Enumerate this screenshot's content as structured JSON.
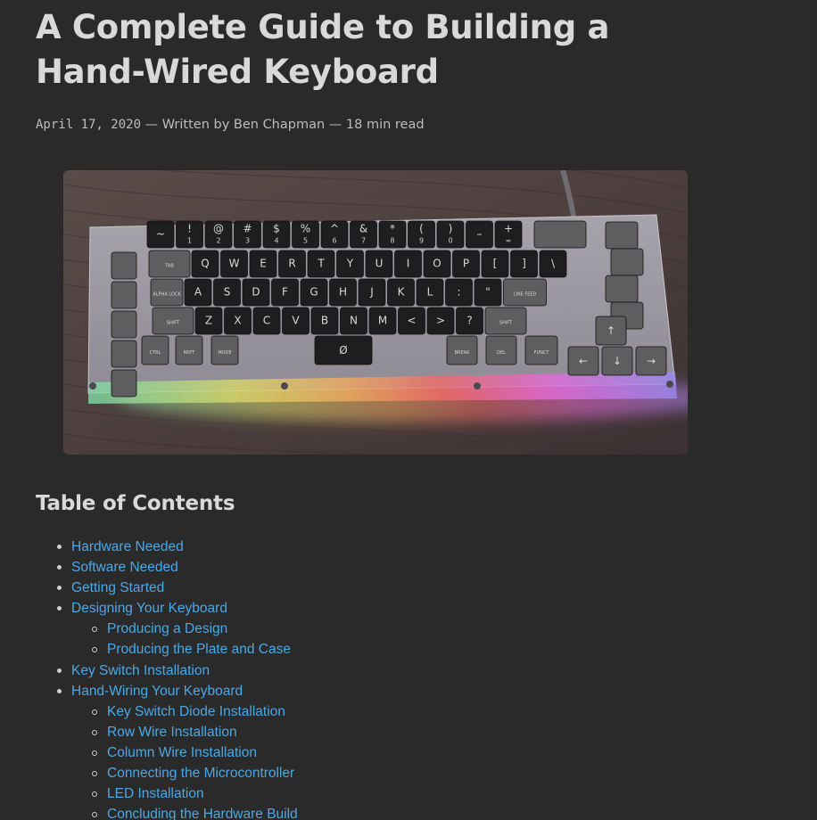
{
  "article": {
    "title": "A Complete Guide to Building a Hand-Wired Keyboard",
    "meta": {
      "date": "April 17, 2020",
      "separator1": " — ",
      "author": "Written by Ben Chapman",
      "separator2": " — ",
      "read_time": "18 min read"
    },
    "hero_image": {
      "keycap_legends": {
        "row1": [
          "~",
          "!",
          "@",
          "#",
          "$",
          "%",
          "^",
          "&",
          "*",
          "(",
          ")",
          "–",
          "+"
        ],
        "row1_sub": [
          "",
          "1",
          "2",
          "3",
          "4",
          "5",
          "6",
          "7",
          "8",
          "9",
          "0",
          "",
          "="
        ],
        "row2": [
          "TAB",
          "Q",
          "W",
          "E",
          "R",
          "T",
          "Y",
          "U",
          "I",
          "O",
          "P",
          "[",
          "]",
          "\\"
        ],
        "row3": [
          "ALPHA LOCK",
          "A",
          "S",
          "D",
          "F",
          "G",
          "H",
          "J",
          "K",
          "L",
          ":",
          "\"",
          "LINE FEED"
        ],
        "row4": [
          "SHIFT",
          "Z",
          "X",
          "C",
          "V",
          "B",
          "N",
          "M",
          "<",
          ">",
          "?",
          "SHIFT"
        ],
        "row5": [
          "CTRL",
          "REPT",
          "MODE",
          "Ø",
          "BREAK",
          "DEL",
          "FUNCT"
        ]
      }
    }
  },
  "toc": {
    "heading": "Table of Contents",
    "items": [
      {
        "label": "Hardware Needed",
        "level": 1
      },
      {
        "label": "Software Needed",
        "level": 1
      },
      {
        "label": "Getting Started",
        "level": 1
      },
      {
        "label": "Designing Your Keyboard",
        "level": 1
      },
      {
        "label": "Producing a Design",
        "level": 2
      },
      {
        "label": "Producing the Plate and Case",
        "level": 2
      },
      {
        "label": "Key Switch Installation",
        "level": 1
      },
      {
        "label": "Hand-Wiring Your Keyboard",
        "level": 1
      },
      {
        "label": "Key Switch Diode Installation",
        "level": 2
      },
      {
        "label": "Row Wire Installation",
        "level": 2
      },
      {
        "label": "Column Wire Installation",
        "level": 2
      },
      {
        "label": "Connecting the Microcontroller",
        "level": 2
      },
      {
        "label": "LED Installation",
        "level": 2
      },
      {
        "label": "Concluding the Hardware Build",
        "level": 2
      }
    ]
  },
  "colors": {
    "background": "#2b2a2b",
    "heading": "#d9d9d9",
    "meta": "#bdbdbd",
    "link": "#4aa8e6"
  }
}
